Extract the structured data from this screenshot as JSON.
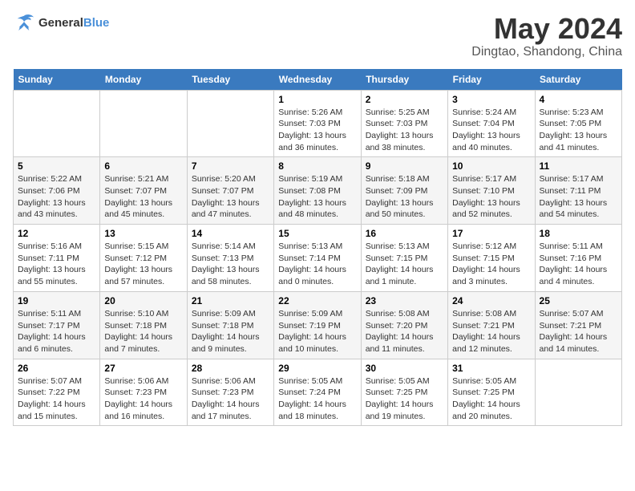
{
  "header": {
    "logo_line1": "General",
    "logo_line2": "Blue",
    "month": "May 2024",
    "location": "Dingtao, Shandong, China"
  },
  "weekdays": [
    "Sunday",
    "Monday",
    "Tuesday",
    "Wednesday",
    "Thursday",
    "Friday",
    "Saturday"
  ],
  "weeks": [
    [
      {
        "day": "",
        "info": ""
      },
      {
        "day": "",
        "info": ""
      },
      {
        "day": "",
        "info": ""
      },
      {
        "day": "1",
        "info": "Sunrise: 5:26 AM\nSunset: 7:03 PM\nDaylight: 13 hours\nand 36 minutes."
      },
      {
        "day": "2",
        "info": "Sunrise: 5:25 AM\nSunset: 7:03 PM\nDaylight: 13 hours\nand 38 minutes."
      },
      {
        "day": "3",
        "info": "Sunrise: 5:24 AM\nSunset: 7:04 PM\nDaylight: 13 hours\nand 40 minutes."
      },
      {
        "day": "4",
        "info": "Sunrise: 5:23 AM\nSunset: 7:05 PM\nDaylight: 13 hours\nand 41 minutes."
      }
    ],
    [
      {
        "day": "5",
        "info": "Sunrise: 5:22 AM\nSunset: 7:06 PM\nDaylight: 13 hours\nand 43 minutes."
      },
      {
        "day": "6",
        "info": "Sunrise: 5:21 AM\nSunset: 7:07 PM\nDaylight: 13 hours\nand 45 minutes."
      },
      {
        "day": "7",
        "info": "Sunrise: 5:20 AM\nSunset: 7:07 PM\nDaylight: 13 hours\nand 47 minutes."
      },
      {
        "day": "8",
        "info": "Sunrise: 5:19 AM\nSunset: 7:08 PM\nDaylight: 13 hours\nand 48 minutes."
      },
      {
        "day": "9",
        "info": "Sunrise: 5:18 AM\nSunset: 7:09 PM\nDaylight: 13 hours\nand 50 minutes."
      },
      {
        "day": "10",
        "info": "Sunrise: 5:17 AM\nSunset: 7:10 PM\nDaylight: 13 hours\nand 52 minutes."
      },
      {
        "day": "11",
        "info": "Sunrise: 5:17 AM\nSunset: 7:11 PM\nDaylight: 13 hours\nand 54 minutes."
      }
    ],
    [
      {
        "day": "12",
        "info": "Sunrise: 5:16 AM\nSunset: 7:11 PM\nDaylight: 13 hours\nand 55 minutes."
      },
      {
        "day": "13",
        "info": "Sunrise: 5:15 AM\nSunset: 7:12 PM\nDaylight: 13 hours\nand 57 minutes."
      },
      {
        "day": "14",
        "info": "Sunrise: 5:14 AM\nSunset: 7:13 PM\nDaylight: 13 hours\nand 58 minutes."
      },
      {
        "day": "15",
        "info": "Sunrise: 5:13 AM\nSunset: 7:14 PM\nDaylight: 14 hours\nand 0 minutes."
      },
      {
        "day": "16",
        "info": "Sunrise: 5:13 AM\nSunset: 7:15 PM\nDaylight: 14 hours\nand 1 minute."
      },
      {
        "day": "17",
        "info": "Sunrise: 5:12 AM\nSunset: 7:15 PM\nDaylight: 14 hours\nand 3 minutes."
      },
      {
        "day": "18",
        "info": "Sunrise: 5:11 AM\nSunset: 7:16 PM\nDaylight: 14 hours\nand 4 minutes."
      }
    ],
    [
      {
        "day": "19",
        "info": "Sunrise: 5:11 AM\nSunset: 7:17 PM\nDaylight: 14 hours\nand 6 minutes."
      },
      {
        "day": "20",
        "info": "Sunrise: 5:10 AM\nSunset: 7:18 PM\nDaylight: 14 hours\nand 7 minutes."
      },
      {
        "day": "21",
        "info": "Sunrise: 5:09 AM\nSunset: 7:18 PM\nDaylight: 14 hours\nand 9 minutes."
      },
      {
        "day": "22",
        "info": "Sunrise: 5:09 AM\nSunset: 7:19 PM\nDaylight: 14 hours\nand 10 minutes."
      },
      {
        "day": "23",
        "info": "Sunrise: 5:08 AM\nSunset: 7:20 PM\nDaylight: 14 hours\nand 11 minutes."
      },
      {
        "day": "24",
        "info": "Sunrise: 5:08 AM\nSunset: 7:21 PM\nDaylight: 14 hours\nand 12 minutes."
      },
      {
        "day": "25",
        "info": "Sunrise: 5:07 AM\nSunset: 7:21 PM\nDaylight: 14 hours\nand 14 minutes."
      }
    ],
    [
      {
        "day": "26",
        "info": "Sunrise: 5:07 AM\nSunset: 7:22 PM\nDaylight: 14 hours\nand 15 minutes."
      },
      {
        "day": "27",
        "info": "Sunrise: 5:06 AM\nSunset: 7:23 PM\nDaylight: 14 hours\nand 16 minutes."
      },
      {
        "day": "28",
        "info": "Sunrise: 5:06 AM\nSunset: 7:23 PM\nDaylight: 14 hours\nand 17 minutes."
      },
      {
        "day": "29",
        "info": "Sunrise: 5:05 AM\nSunset: 7:24 PM\nDaylight: 14 hours\nand 18 minutes."
      },
      {
        "day": "30",
        "info": "Sunrise: 5:05 AM\nSunset: 7:25 PM\nDaylight: 14 hours\nand 19 minutes."
      },
      {
        "day": "31",
        "info": "Sunrise: 5:05 AM\nSunset: 7:25 PM\nDaylight: 14 hours\nand 20 minutes."
      },
      {
        "day": "",
        "info": ""
      }
    ]
  ]
}
